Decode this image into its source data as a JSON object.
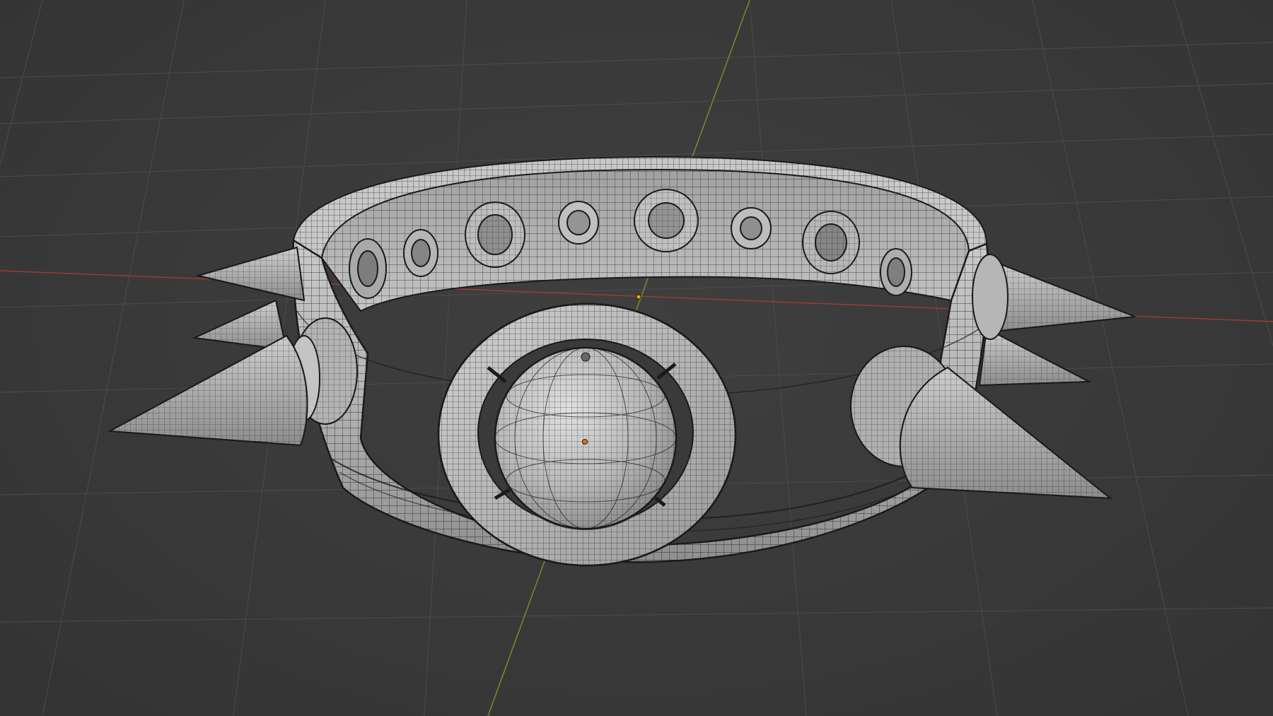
{
  "viewport": {
    "background_color": "#3a3a3a",
    "grid_color": "#4a4a4a",
    "x_axis_color": "#9a3b3b",
    "y_axis_color": "#6f8f2e",
    "mesh_fill_color": "#b9b9b9",
    "wire_color": "#1c1c1c",
    "origin_point_color": "#ff8a00"
  },
  "scene": {
    "object": "spiked-collar",
    "shading": "solid-with-wireframe"
  }
}
